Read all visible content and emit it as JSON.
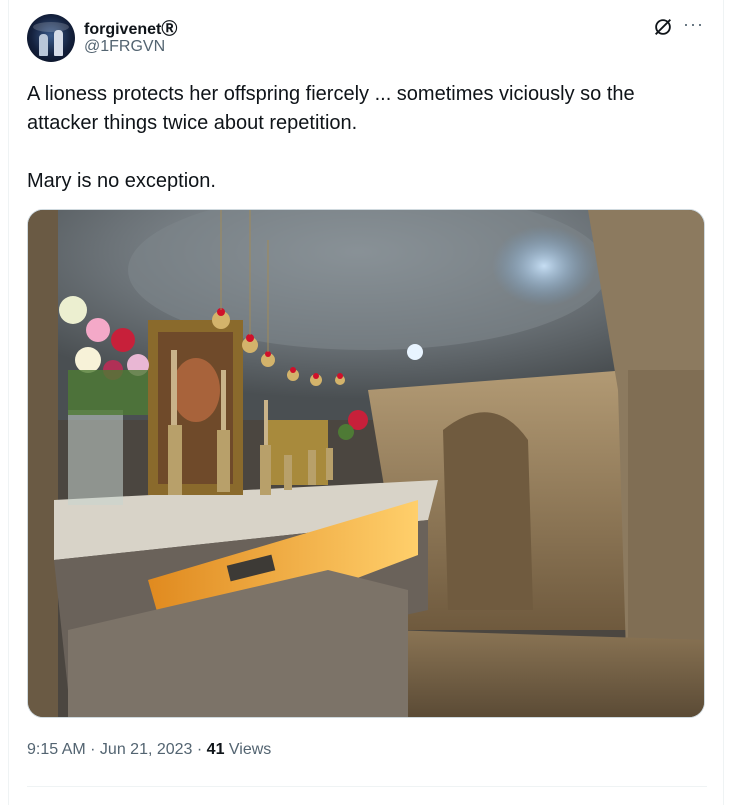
{
  "user": {
    "display_name": "forgivenetⓇ",
    "handle": "@1FRGVN"
  },
  "icons": {
    "grok": "grok-slash-icon",
    "more": "more-dots-icon"
  },
  "tweet": {
    "paragraphs": [
      "A lioness protects her offspring fiercely ... sometimes viciously so the attacker things twice about repetition.",
      "Mary is no exception."
    ]
  },
  "meta": {
    "time": "9:15 AM",
    "sep1": " · ",
    "date": "Jun 21, 2023",
    "sep2": " · ",
    "views_count": "41",
    "views_label": " Views"
  },
  "colors": {
    "text": "#0f1419",
    "muted": "#536471",
    "border": "#cfd9de"
  }
}
